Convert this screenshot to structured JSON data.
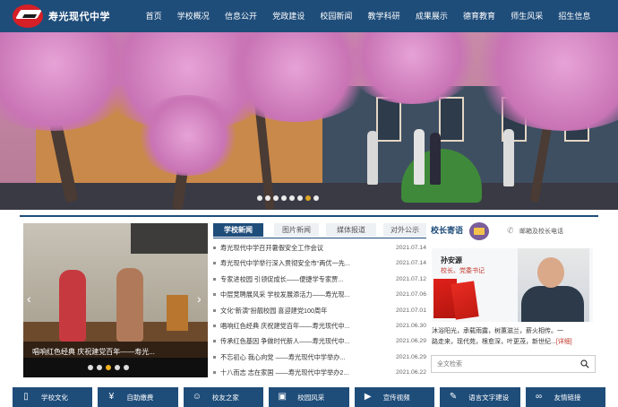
{
  "header": {
    "school_name": "寿光现代中学",
    "nav": [
      "首页",
      "学校概况",
      "信息公开",
      "党政建设",
      "校园新闻",
      "教学科研",
      "成果展示",
      "德育教育",
      "师生风采",
      "招生信息"
    ]
  },
  "banner": {
    "slide_count": 8,
    "active_slide": 6
  },
  "slider": {
    "caption": "唱响红色经典 庆祝建党百年——寿光...",
    "slide_count": 5,
    "active_slide": 2
  },
  "tabs": [
    "学校新闻",
    "图片新闻",
    "媒体报道",
    "对外公示"
  ],
  "active_tab": 0,
  "news": [
    {
      "title": "寿光现代中学召开暑假安全工作会议",
      "date": "2021.07.14"
    },
    {
      "title": "寿光现代中学举行深入贯彻安全市“两优一先...",
      "date": "2021.07.14"
    },
    {
      "title": "专家进校园 引领促成长——便捷学专家贾...",
      "date": "2021.07.12"
    },
    {
      "title": "中层竞聘展风采 学校发展添活力——寿光现...",
      "date": "2021.07.06"
    },
    {
      "title": "文化“新演”扮靓校园 喜迎建党100周年",
      "date": "2021.07.01"
    },
    {
      "title": "唱响红色经典 庆祝建党百年——寿光现代中...",
      "date": "2021.06.30"
    },
    {
      "title": "传承红色基因 争做时代新人——寿光现代中...",
      "date": "2021.06.29"
    },
    {
      "title": "不忘初心 我心向党 ——寿光现代中学举办...",
      "date": "2021.06.29"
    },
    {
      "title": "十八而志 志在家国 ——寿光现代中学举办2...",
      "date": "2021.06.22"
    }
  ],
  "principal": {
    "section_title": "校长寄语",
    "mail_link": "邮箱及校长电话",
    "name": "孙安源",
    "role": "校长、党委书记",
    "desc_line1": "沐浴阳光，承载雨露，树蕙滋兰，薪火相传。一",
    "desc_line2": "路走来，现代苑，根愈深，叶更茂，新世纪...",
    "detail_label": "[详细]"
  },
  "search": {
    "placeholder": "全文检索"
  },
  "bottom_links": [
    {
      "label": "学校文化",
      "icon": "book-icon"
    },
    {
      "label": "自助缴费",
      "icon": "payment-icon"
    },
    {
      "label": "校友之家",
      "icon": "user-icon"
    },
    {
      "label": "校园风采",
      "icon": "image-icon"
    },
    {
      "label": "宣传视频",
      "icon": "video-icon"
    },
    {
      "label": "语言文字建设",
      "icon": "edit-icon"
    },
    {
      "label": "友情链接",
      "icon": "link-icon"
    }
  ],
  "colors": {
    "primary": "#1f4d7a",
    "accent": "#f0b020",
    "highlight": "#c0392b"
  }
}
